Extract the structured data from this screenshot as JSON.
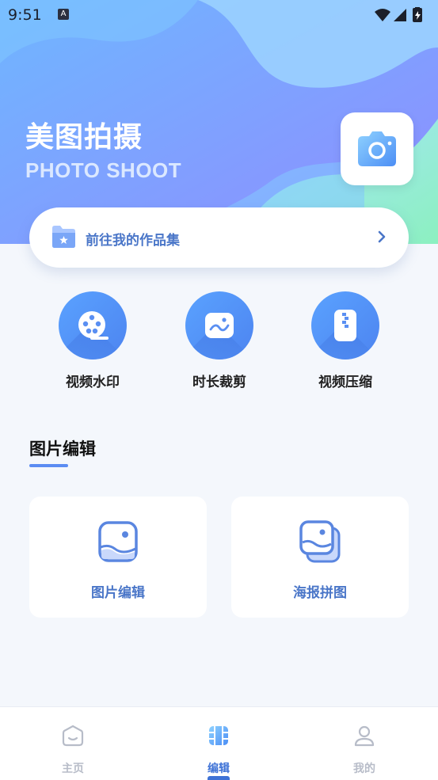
{
  "status_bar": {
    "time": "9:51",
    "notif_icon": "a-icon",
    "signal_icon": "wifi-signal-battery"
  },
  "hero": {
    "title": "美图拍摄",
    "subtitle": "PHOTO SHOOT",
    "camera_icon": "camera-icon",
    "colors": {
      "bg_start": "#7cc0ff",
      "bg_end": "#7b9cff",
      "wave": "#a4dcff",
      "green": "#8ff2b8"
    }
  },
  "portfolio": {
    "label": "前往我的作品集",
    "icon": "folder-star-icon",
    "chevron": "chevron-right-icon"
  },
  "tools": [
    {
      "label": "视频水印",
      "icon": "film-reel-icon"
    },
    {
      "label": "时长裁剪",
      "icon": "image-crop-icon"
    },
    {
      "label": "视频压缩",
      "icon": "zip-file-icon"
    }
  ],
  "section": {
    "title": "图片编辑"
  },
  "cards": [
    {
      "label": "图片编辑",
      "icon": "image-edit-icon"
    },
    {
      "label": "海报拼图",
      "icon": "poster-collage-icon"
    }
  ],
  "tabbar": {
    "items": [
      {
        "label": "主页",
        "icon": "home-icon",
        "active": false
      },
      {
        "label": "编辑",
        "icon": "film-edit-icon",
        "active": true
      },
      {
        "label": "我的",
        "icon": "profile-icon",
        "active": false
      }
    ]
  },
  "accent": "#4a76c8"
}
